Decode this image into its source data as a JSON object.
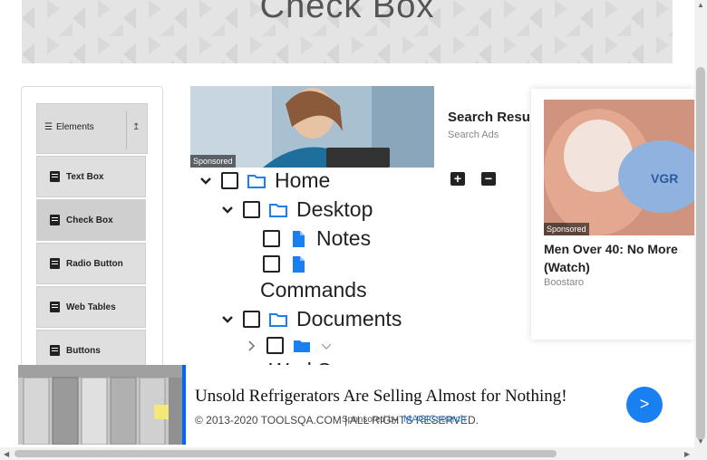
{
  "banner": {
    "title": "Check Box"
  },
  "sidebar": {
    "group_label": "Elements",
    "items": [
      {
        "label": "Text Box"
      },
      {
        "label": "Check Box"
      },
      {
        "label": "Radio Button"
      },
      {
        "label": "Web Tables"
      },
      {
        "label": "Buttons"
      }
    ]
  },
  "ad_top": {
    "tag": "Sponsored"
  },
  "search": {
    "title": "Search Resu",
    "subtitle": "Search Ads"
  },
  "tree": {
    "home": "Home",
    "desktop": "Desktop",
    "notes": "Notes",
    "commands": "Commands",
    "documents": "Documents",
    "workspace": "WorkSpace"
  },
  "side_ad": {
    "tag": "Sponsored",
    "headline": "Men Over 40: No More (Watch)",
    "source": "Boostaro"
  },
  "bottom_ad": {
    "headline": "Unsold Refrigerators Are Selling Almost for Nothing!",
    "copyright": "© 2013-2020 TOOLSQA.COM | ALL RIGHTS RESERVED.",
    "sponsored_by": "Sponsored by",
    "sponsor": "MAGICsearch",
    "next": ">"
  },
  "colors": {
    "accent": "#1a7ff0",
    "bar": "#0066ff"
  }
}
